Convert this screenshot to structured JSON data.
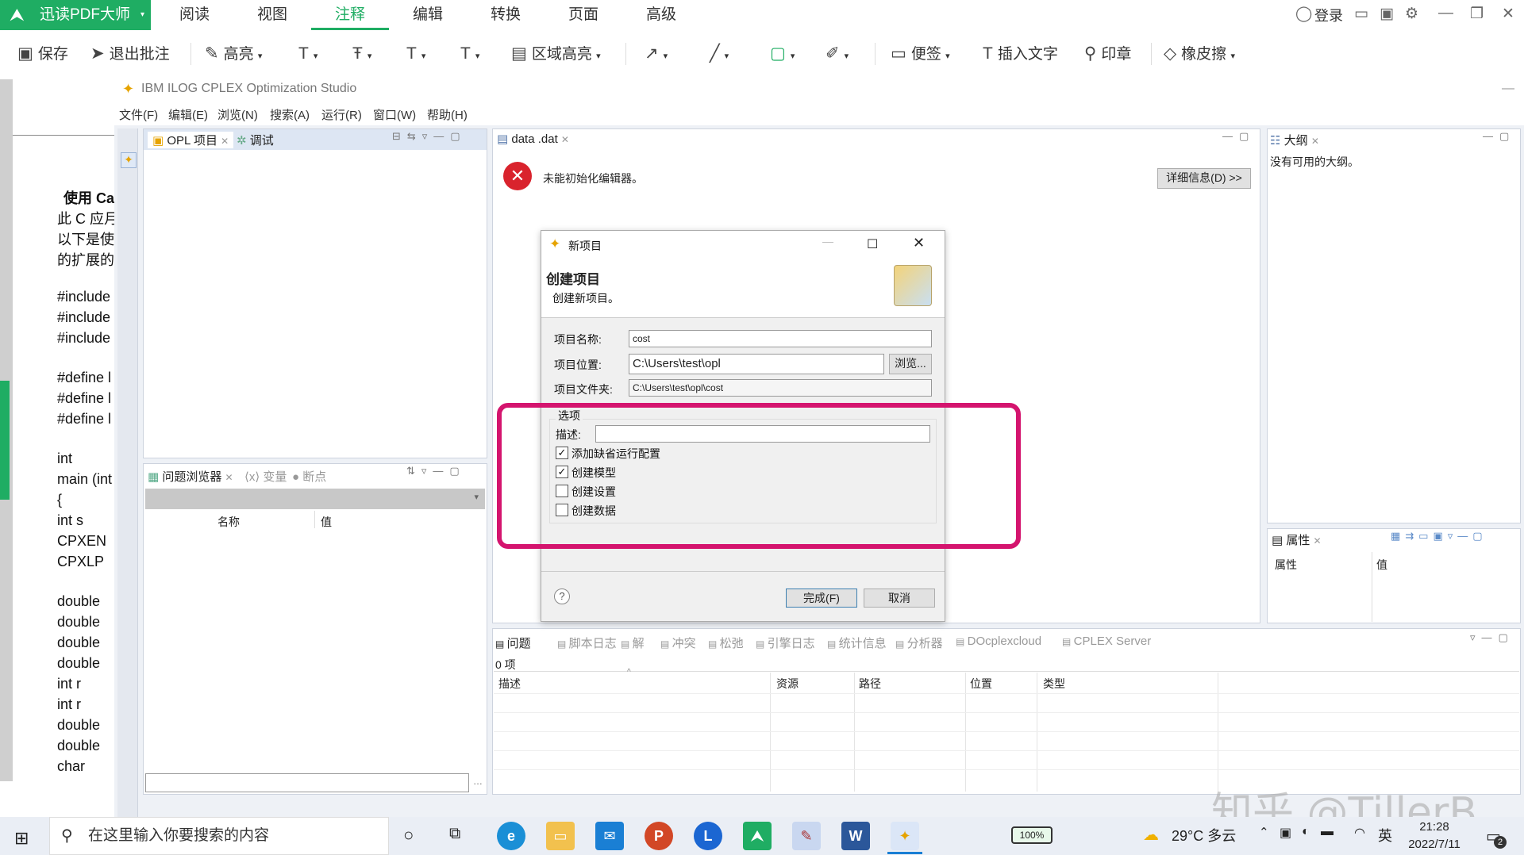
{
  "pdf_app": {
    "name": "迅读PDF大师",
    "tabs": [
      "阅读",
      "视图",
      "注释",
      "编辑",
      "转换",
      "页面",
      "高级"
    ],
    "login": "登录"
  },
  "pdf_toolbar": {
    "save": "保存",
    "exit_annot": "退出批注",
    "highlight": "高亮",
    "area_highlight": "区域高亮",
    "note": "便签",
    "insert_text": "插入文字",
    "stamp": "印章",
    "eraser": "橡皮擦"
  },
  "doc": {
    "lines": [
      "使用 Ca",
      "此 C 应月",
      "以下是使",
      "的扩展的",
      "#include",
      "#include",
      "#include",
      "#define l",
      "#define l",
      "#define l",
      "int",
      "main (int",
      "{",
      "int     s",
      "CPXEN",
      "CPXLP",
      "double",
      "double",
      "double",
      "double",
      "int     r",
      "int     r",
      "double",
      "double",
      "char"
    ]
  },
  "ide": {
    "title": "IBM ILOG CPLEX Optimization Studio",
    "menu": [
      "文件(F)",
      "编辑(E)",
      "浏览(N)",
      "搜索(A)",
      "运行(R)",
      "窗口(W)",
      "帮助(H)"
    ],
    "left_tabs": [
      "OPL 项目",
      "调试"
    ],
    "problem_tabs": [
      "问题浏览器",
      "变量",
      "断点"
    ],
    "problem_cols": [
      "名称",
      "值"
    ],
    "editor_tab": "data .dat",
    "editor_error": "未能初始化编辑器。",
    "details_button": "详细信息(D) >>",
    "outline_tab": "大纲",
    "outline_empty": "没有可用的大纲。",
    "props_tab": "属性",
    "props_cols": [
      "属性",
      "值"
    ],
    "bottom_tabs": [
      "问题",
      "脚本日志",
      "解",
      "冲突",
      "松弛",
      "引擎日志",
      "统计信息",
      "分析器",
      "DOcplexcloud",
      "CPLEX Server"
    ],
    "bottom_count": "0 项",
    "bottom_cols": [
      "描述",
      "资源",
      "路径",
      "位置",
      "类型"
    ]
  },
  "dialog": {
    "title": "新项目",
    "heading": "创建项目",
    "subheading": "创建新项目。",
    "name_label": "项目名称:",
    "name_value": "cost",
    "location_label": "项目位置:",
    "location_value": "C:\\Users\\test\\opl",
    "browse": "浏览...",
    "folder_label": "项目文件夹:",
    "folder_value": "C:\\Users\\test\\opl\\cost",
    "options_label": "选项",
    "desc_label": "描述:",
    "desc_value": "",
    "options": [
      {
        "label": "添加缺省运行配置",
        "checked": true
      },
      {
        "label": "创建模型",
        "checked": true
      },
      {
        "label": "创建设置",
        "checked": false
      },
      {
        "label": "创建数据",
        "checked": false
      }
    ],
    "finish": "完成(F)",
    "cancel": "取消"
  },
  "taskbar": {
    "search_placeholder": "在这里输入你要搜索的内容",
    "battery": "100%",
    "weather": "29°C  多云",
    "ime": "英",
    "time": "21:28",
    "date": "2022/7/11",
    "notif_count": "2"
  },
  "watermark": "知乎 @TillerB",
  "colors": {
    "brand_green": "#1fad63",
    "highlight_box": "#d4146e"
  }
}
